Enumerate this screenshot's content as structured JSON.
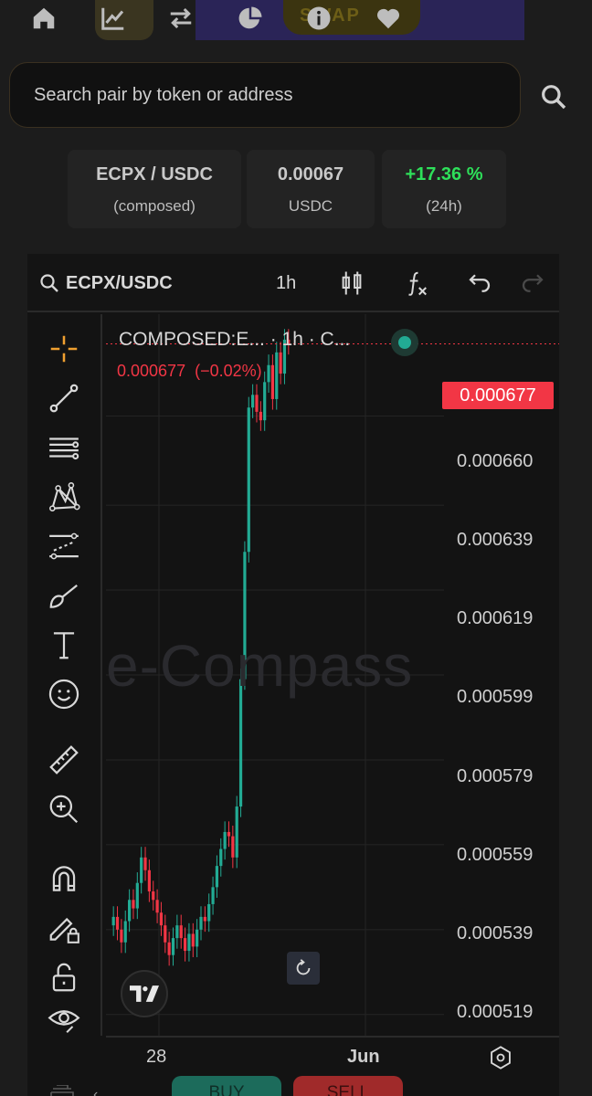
{
  "nav": {
    "items": [
      {
        "name": "home-icon"
      },
      {
        "name": "chart-icon"
      },
      {
        "name": "swap-arrows-icon"
      },
      {
        "name": "pie-chart-icon"
      },
      {
        "name": "info-icon"
      },
      {
        "name": "heart-icon"
      }
    ],
    "banner_text": "SWAP"
  },
  "search": {
    "placeholder": "Search pair by token or address"
  },
  "stats": {
    "pair": "ECPX / USDC",
    "pair_sub": "(composed)",
    "price": "0.00067",
    "price_unit": "USDC",
    "change": "+17.36 %",
    "change_period": "(24h)"
  },
  "toolbar": {
    "symbol": "ECPX/USDC",
    "interval": "1h"
  },
  "chart_legend": {
    "title": "COMPOSED:E... · 1h · C...",
    "last": "0.000677",
    "change": "(−0.02%)"
  },
  "watermark": "e-Compass",
  "price_tag": "0.000677",
  "y_ticks": [
    "0.000660",
    "0.000639",
    "0.000619",
    "0.000599",
    "0.000579",
    "0.000559",
    "0.000539",
    "0.000519"
  ],
  "x_ticks": [
    "28",
    "Jun"
  ],
  "buttons": {
    "buy": "BUY",
    "sell": "SELL"
  },
  "colors": {
    "up": "#22ab94",
    "down": "#f23645",
    "positive_change": "#2ee05a"
  },
  "chart_data": {
    "type": "candlestick",
    "title": "",
    "ylim": [
      0.000514,
      0.000684
    ],
    "last_price": 0.000677,
    "close": [
      0.000542,
      0.000539,
      0.000536,
      0.000541,
      0.000546,
      0.000544,
      0.00055,
      0.000556,
      0.000553,
      0.000548,
      0.000546,
      0.000543,
      0.00054,
      0.000536,
      0.000533,
      0.000537,
      0.00054,
      0.000537,
      0.000534,
      0.000538,
      0.000535,
      0.000539,
      0.000542,
      0.000541,
      0.000545,
      0.000549,
      0.000554,
      0.000558,
      0.000562,
      0.000561,
      0.000556,
      0.000568,
      0.000598,
      0.000628,
      0.000662,
      0.000665,
      0.000661,
      0.000659,
      0.000668,
      0.000672,
      0.000664,
      0.000675,
      0.00067,
      0.000678,
      0.000677
    ]
  }
}
